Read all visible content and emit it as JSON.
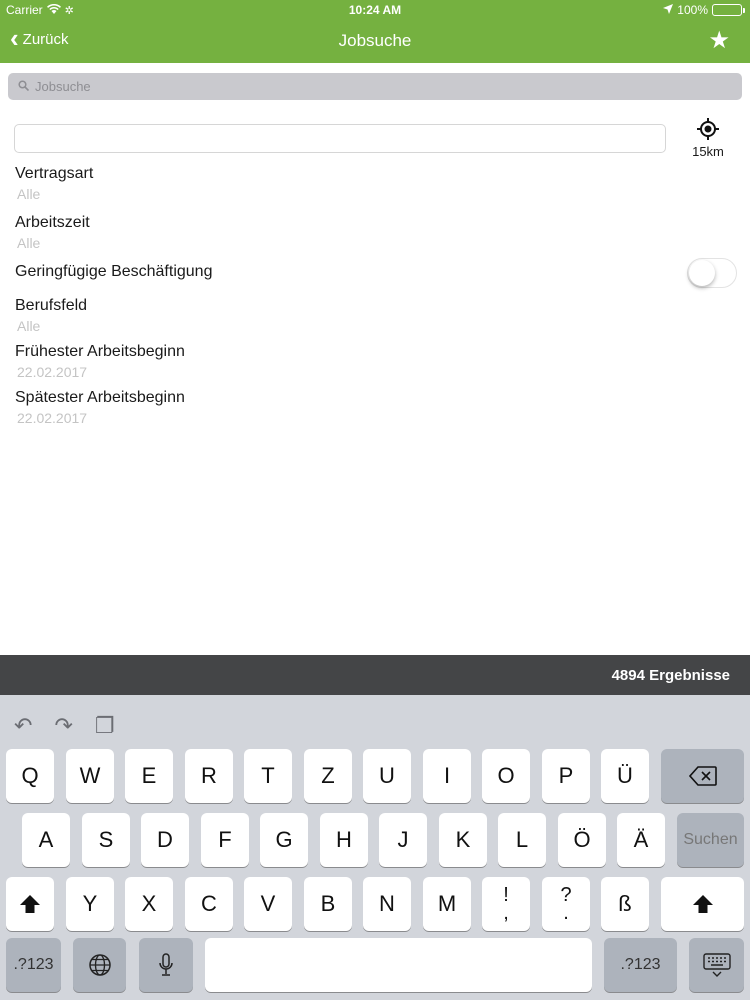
{
  "status": {
    "carrier": "Carrier",
    "time": "10:24 AM",
    "battery": "100%"
  },
  "nav": {
    "back_label": "Zurück",
    "title": "Jobsuche"
  },
  "search": {
    "placeholder": "Jobsuche"
  },
  "location": {
    "radius": "15km"
  },
  "filters": {
    "contract": {
      "label": "Vertragsart",
      "value": "Alle"
    },
    "worktime": {
      "label": "Arbeitszeit",
      "value": "Alle"
    },
    "minijob": {
      "label": "Geringfügige Beschäftigung",
      "enabled": false
    },
    "field": {
      "label": "Berufsfeld",
      "value": "Alle"
    },
    "earliest": {
      "label": "Frühester Arbeitsbeginn",
      "value": "22.02.2017"
    },
    "latest": {
      "label": "Spätester Arbeitsbeginn",
      "value": "22.02.2017"
    }
  },
  "results": {
    "label": "4894 Ergebnisse"
  },
  "keyboard": {
    "row1": [
      "Q",
      "W",
      "E",
      "R",
      "T",
      "Z",
      "U",
      "I",
      "O",
      "P",
      "Ü"
    ],
    "row2": [
      "A",
      "S",
      "D",
      "F",
      "G",
      "H",
      "J",
      "K",
      "L",
      "Ö",
      "Ä"
    ],
    "row3": [
      "Y",
      "X",
      "C",
      "V",
      "B",
      "N",
      "M"
    ],
    "punct1": [
      "!",
      ","
    ],
    "punct2": [
      "?",
      "."
    ],
    "eszett": "ß",
    "search_key": "Suchen",
    "numbers_key": ".?123"
  },
  "colors": {
    "nav": "#75b140",
    "results_bar": "#444547",
    "keyboard": "#d2d5db"
  }
}
